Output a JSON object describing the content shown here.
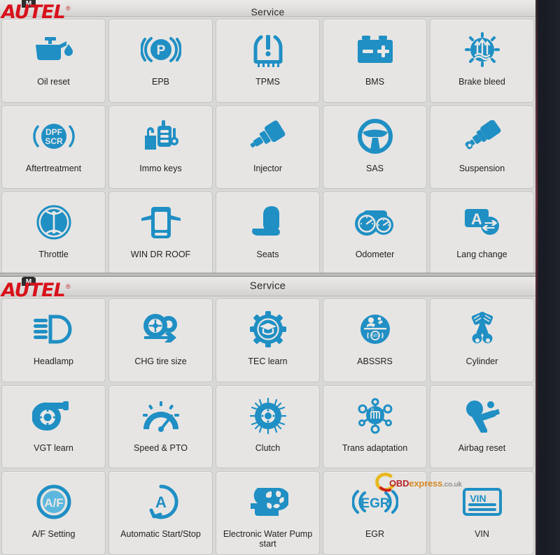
{
  "brand": {
    "name": "AUTEL",
    "registered_mark": "®",
    "logo_color": "#d8111b",
    "icon": "autel-house-m-icon"
  },
  "accent_color": "#1f8fc4",
  "panel_bg": "#d8d8d6",
  "tile_bg": "#e6e5e3",
  "panels": [
    {
      "header": {
        "title": "Service"
      },
      "tiles": [
        {
          "label": "Oil reset",
          "icon": "oil-can-icon"
        },
        {
          "label": "EPB",
          "icon": "parking-brake-icon"
        },
        {
          "label": "TPMS",
          "icon": "tire-pressure-icon"
        },
        {
          "label": "BMS",
          "icon": "battery-icon"
        },
        {
          "label": "Brake bleed",
          "icon": "brake-bleed-icon"
        },
        {
          "label": "Aftertreatment",
          "icon": "dpf-scr-icon"
        },
        {
          "label": "Immo keys",
          "icon": "immobilizer-key-icon"
        },
        {
          "label": "Injector",
          "icon": "fuel-injector-icon"
        },
        {
          "label": "SAS",
          "icon": "steering-wheel-icon"
        },
        {
          "label": "Suspension",
          "icon": "shock-absorber-icon"
        },
        {
          "label": "Throttle",
          "icon": "throttle-body-icon"
        },
        {
          "label": "WIN DR ROOF",
          "icon": "car-doors-roof-icon"
        },
        {
          "label": "Seats",
          "icon": "car-seat-icon"
        },
        {
          "label": "Odometer",
          "icon": "odometer-gauges-icon"
        },
        {
          "label": "Lang change",
          "icon": "language-swap-icon"
        }
      ]
    },
    {
      "header": {
        "title": "Service"
      },
      "tiles": [
        {
          "label": "Headlamp",
          "icon": "headlamp-icon"
        },
        {
          "label": "CHG tire size",
          "icon": "tire-size-change-icon"
        },
        {
          "label": "TEC learn",
          "icon": "gear-graduation-icon"
        },
        {
          "label": "ABSSRS",
          "icon": "abs-srs-icon"
        },
        {
          "label": "Cylinder",
          "icon": "piston-rods-icon"
        },
        {
          "label": "VGT learn",
          "icon": "turbocharger-icon"
        },
        {
          "label": "Speed & PTO",
          "icon": "speedometer-icon"
        },
        {
          "label": "Clutch",
          "icon": "clutch-disc-icon"
        },
        {
          "label": "Trans adaptation",
          "icon": "gear-shifter-icon"
        },
        {
          "label": "Airbag reset",
          "icon": "airbag-crash-icon"
        },
        {
          "label": "A/F Setting",
          "icon": "air-fuel-ratio-icon"
        },
        {
          "label": "Automatic Start/Stop",
          "icon": "auto-start-stop-icon"
        },
        {
          "label": "Electronic Water Pump start",
          "icon": "water-pump-icon"
        },
        {
          "label": "EGR",
          "icon": "egr-valve-icon"
        },
        {
          "label": "VIN",
          "icon": "vin-plate-icon"
        }
      ]
    }
  ],
  "watermark": {
    "text_obd": "OBD",
    "text_express": "express",
    "text_tld": ".co.uk",
    "full": "OBDexpress.co.uk"
  }
}
